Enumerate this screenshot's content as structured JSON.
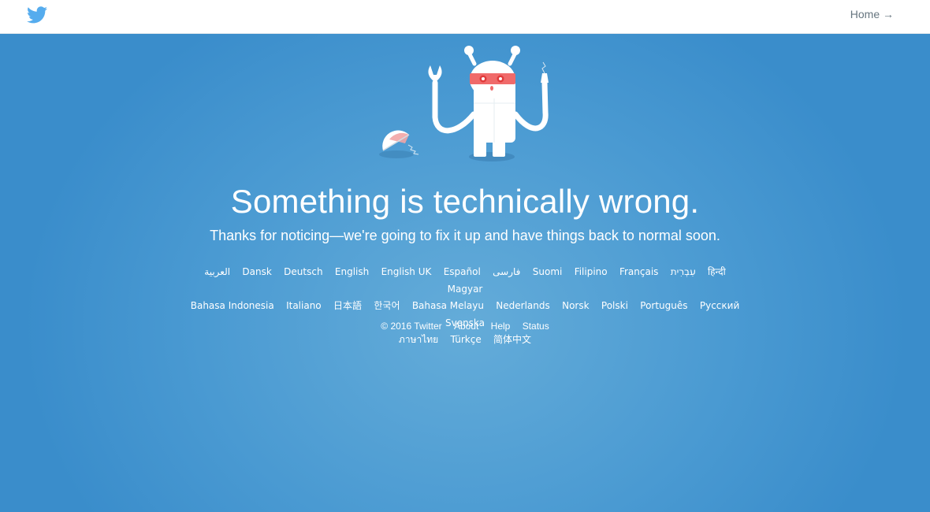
{
  "header": {
    "home_label": "Home →",
    "logo_icon": "twitter-bird-icon",
    "logo_color": "#55acee"
  },
  "main": {
    "illustration_icon": "broken-robot-icon",
    "headline": "Something is technically wrong.",
    "subline": "Thanks for noticing—we're going to fix it up and have things back to normal soon."
  },
  "languages": [
    "العربية",
    "Dansk",
    "Deutsch",
    "English",
    "English UK",
    "Español",
    "فارسی",
    "Suomi",
    "Filipino",
    "Français",
    "עִבְרִית",
    "हिन्दी",
    "Magyar",
    "Bahasa Indonesia",
    "Italiano",
    "日本語",
    "한국어",
    "Bahasa Melayu",
    "Nederlands",
    "Norsk",
    "Polski",
    "Português",
    "Русский",
    "Svenska",
    "ภาษาไทย",
    "Türkçe",
    "简体中文"
  ],
  "footer": {
    "copyright": "© 2016 Twitter",
    "about": "About",
    "help": "Help",
    "status": "Status"
  },
  "colors": {
    "background": "#4a9ad2",
    "background_center": "#64acd9",
    "text": "#ffffff"
  }
}
